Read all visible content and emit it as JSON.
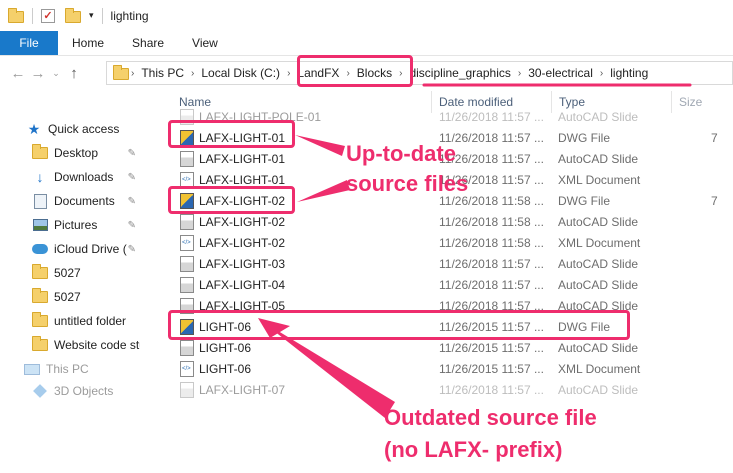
{
  "window": {
    "title": "lighting"
  },
  "ribbon": {
    "tabs": [
      "File",
      "Home",
      "Share",
      "View"
    ]
  },
  "address": {
    "segments": [
      "This PC",
      "Local Disk (C:)",
      "LandFX",
      "Blocks",
      "discipline_graphics",
      "30-electrical",
      "lighting"
    ]
  },
  "columns": {
    "name": "Name",
    "date": "Date modified",
    "type": "Type",
    "size": "Size"
  },
  "sidebar": {
    "items": [
      {
        "label": "Quick access",
        "icon": "star-icon",
        "pinned": false
      },
      {
        "label": "Desktop",
        "icon": "folder-icon",
        "pinned": true
      },
      {
        "label": "Downloads",
        "icon": "download-icon",
        "pinned": true
      },
      {
        "label": "Documents",
        "icon": "documents-icon",
        "pinned": true
      },
      {
        "label": "Pictures",
        "icon": "pictures-icon",
        "pinned": true
      },
      {
        "label": "iCloud Drive (",
        "icon": "cloud-icon",
        "pinned": true
      },
      {
        "label": "5027",
        "icon": "folder-icon",
        "pinned": false
      },
      {
        "label": "5027",
        "icon": "folder-icon",
        "pinned": false
      },
      {
        "label": "untitled folder",
        "icon": "folder-icon",
        "pinned": false
      },
      {
        "label": "Website code stu",
        "icon": "folder-icon",
        "pinned": false
      },
      {
        "label": "This PC",
        "icon": "computer-icon",
        "pinned": false
      },
      {
        "label": "3D Objects",
        "icon": "3d-objects-icon",
        "pinned": false
      }
    ]
  },
  "files": [
    {
      "name": "LAFX-LIGHT-POLE-01",
      "date": "11/26/2018 11:57 ...",
      "type": "AutoCAD Slide",
      "size": "",
      "icon": "slide"
    },
    {
      "name": "LAFX-LIGHT-01",
      "date": "11/26/2018 11:57 ...",
      "type": "DWG File",
      "size": "7",
      "icon": "dwg"
    },
    {
      "name": "LAFX-LIGHT-01",
      "date": "11/26/2018 11:57 ...",
      "type": "AutoCAD Slide",
      "size": "",
      "icon": "slide"
    },
    {
      "name": "LAFX-LIGHT-01",
      "date": "11/26/2018 11:57 ...",
      "type": "XML Document",
      "size": "",
      "icon": "xml"
    },
    {
      "name": "LAFX-LIGHT-02",
      "date": "11/26/2018 11:58 ...",
      "type": "DWG File",
      "size": "7",
      "icon": "dwg"
    },
    {
      "name": "LAFX-LIGHT-02",
      "date": "11/26/2018 11:58 ...",
      "type": "AutoCAD Slide",
      "size": "",
      "icon": "slide"
    },
    {
      "name": "LAFX-LIGHT-02",
      "date": "11/26/2018 11:58 ...",
      "type": "XML Document",
      "size": "",
      "icon": "xml"
    },
    {
      "name": "LAFX-LIGHT-03",
      "date": "11/26/2018 11:57 ...",
      "type": "AutoCAD Slide",
      "size": "",
      "icon": "slide"
    },
    {
      "name": "LAFX-LIGHT-04",
      "date": "11/26/2018 11:57 ...",
      "type": "AutoCAD Slide",
      "size": "",
      "icon": "slide"
    },
    {
      "name": "LAFX-LIGHT-05",
      "date": "11/26/2018 11:57 ...",
      "type": "AutoCAD Slide",
      "size": "",
      "icon": "slide"
    },
    {
      "name": "LIGHT-06",
      "date": "11/26/2015 11:57 ...",
      "type": "DWG File",
      "size": "",
      "icon": "dwg"
    },
    {
      "name": "LIGHT-06",
      "date": "11/26/2015 11:57 ...",
      "type": "AutoCAD Slide",
      "size": "",
      "icon": "slide"
    },
    {
      "name": "LIGHT-06",
      "date": "11/26/2015 11:57 ...",
      "type": "XML Document",
      "size": "",
      "icon": "xml"
    },
    {
      "name": "LAFX-LIGHT-07",
      "date": "11/26/2018 11:57 ...",
      "type": "AutoCAD Slide",
      "size": "",
      "icon": "slide"
    }
  ],
  "annotations": {
    "uptodate_line1": "Up-to-date",
    "uptodate_line2": "source files",
    "outdated_line1": "Outdated source file",
    "outdated_line2": "(no LAFX- prefix)",
    "color": "#ee2d6d"
  }
}
